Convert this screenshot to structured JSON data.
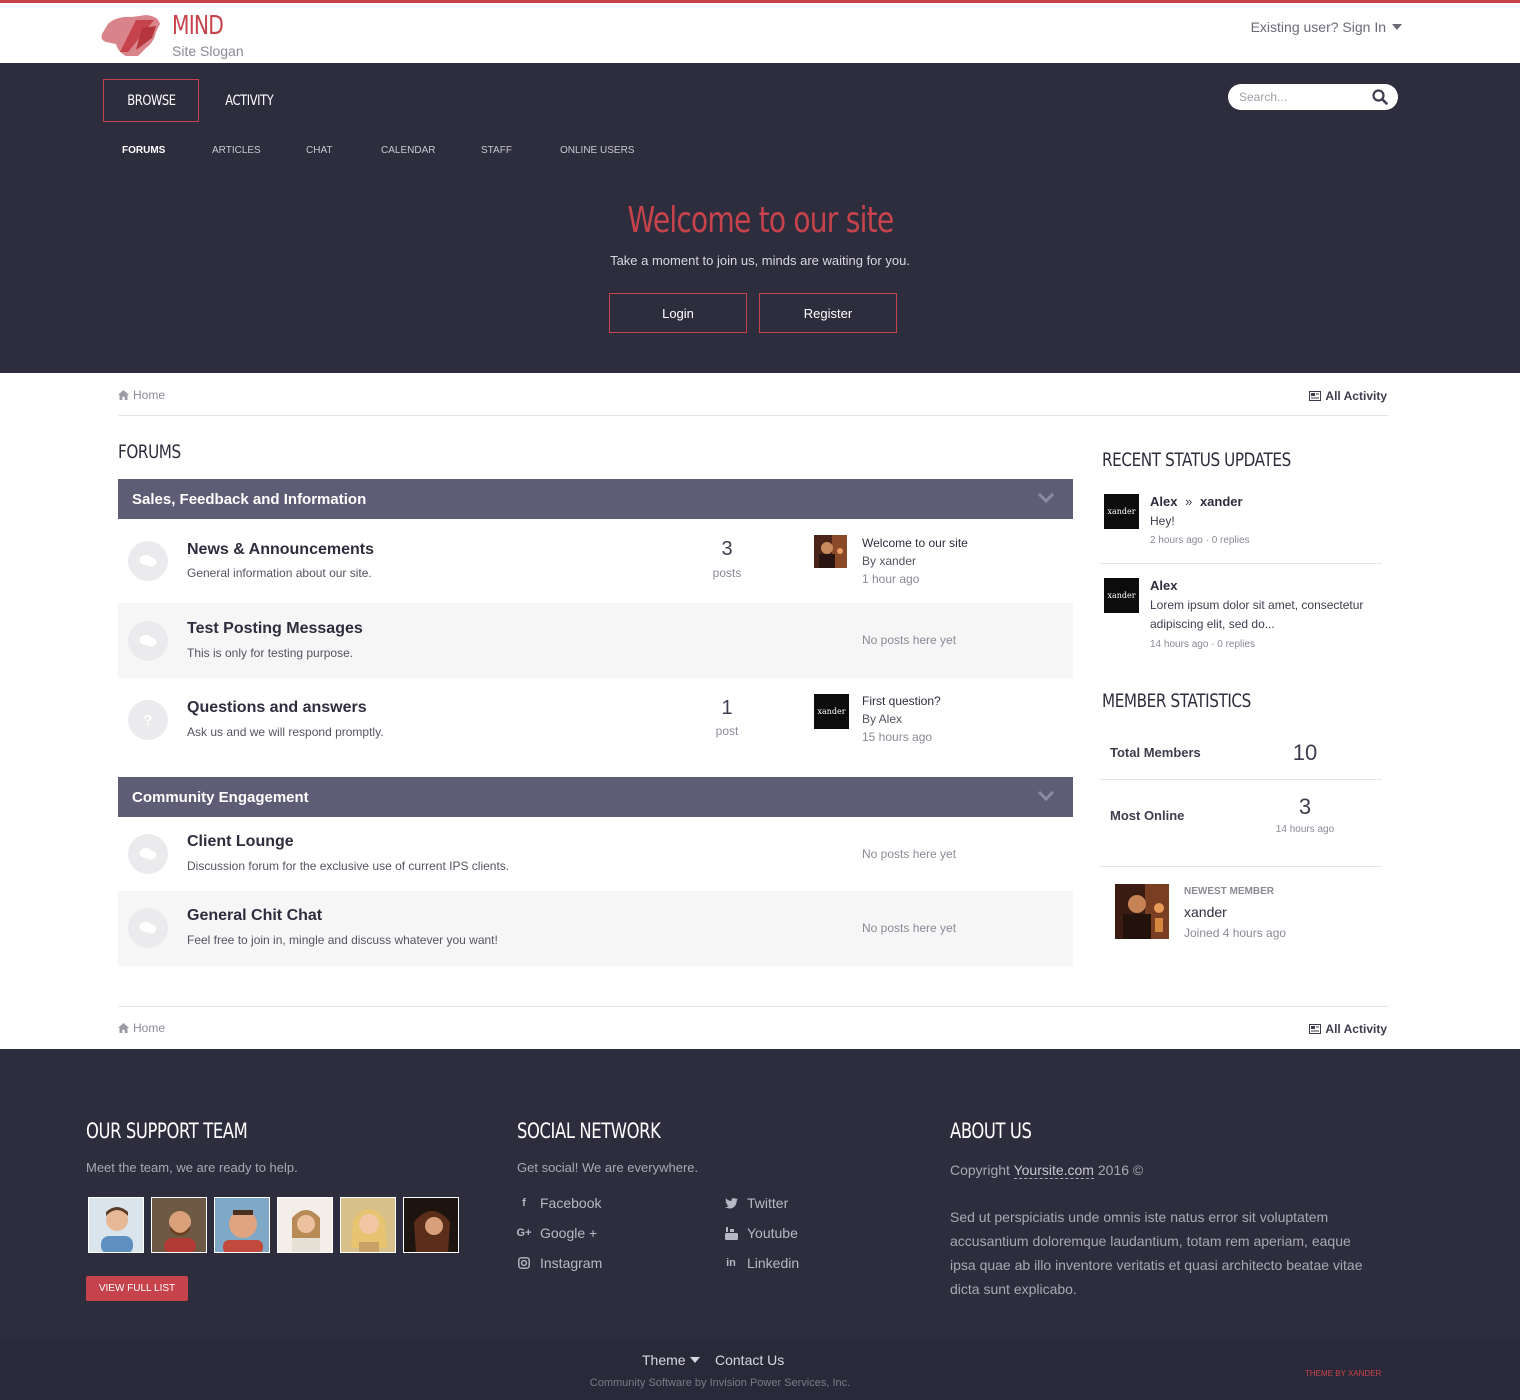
{
  "header": {
    "logo_title": "MIND",
    "logo_slogan": "Site Slogan",
    "signin_label": "Existing user? Sign In"
  },
  "nav": {
    "primary": [
      {
        "label": "BROWSE",
        "active": true
      },
      {
        "label": "ACTIVITY",
        "active": false
      }
    ],
    "secondary": [
      {
        "label": "FORUMS",
        "active": true
      },
      {
        "label": "ARTICLES"
      },
      {
        "label": "CHAT"
      },
      {
        "label": "CALENDAR"
      },
      {
        "label": "STAFF"
      },
      {
        "label": "ONLINE USERS"
      }
    ],
    "search_placeholder": "Search..."
  },
  "hero": {
    "title": "Welcome to our site",
    "subtitle": "Take a moment to join us, minds are waiting for you.",
    "login_label": "Login",
    "register_label": "Register"
  },
  "breadcrumb": {
    "home": "Home",
    "all_activity": "All Activity"
  },
  "forums": {
    "title": "FORUMS",
    "categories": [
      {
        "name": "Sales, Feedback and Information",
        "forums": [
          {
            "name": "News & Announcements",
            "desc": "General information about our site.",
            "count": "3",
            "count_label": "posts",
            "last_title": "Welcome to our site",
            "last_by": "By xander",
            "last_time": "1 hour ago"
          },
          {
            "name": "Test Posting Messages",
            "desc": "This is only for testing purpose.",
            "no_posts": "No posts here yet"
          },
          {
            "name": "Questions and answers",
            "desc": "Ask us and we will respond promptly.",
            "count": "1",
            "count_label": "post",
            "last_title": "First question?",
            "last_by": "By Alex",
            "last_time": "15 hours ago"
          }
        ]
      },
      {
        "name": "Community Engagement",
        "forums": [
          {
            "name": "Client Lounge",
            "desc": "Discussion forum for the exclusive use of current IPS clients.",
            "no_posts": "No posts here yet"
          },
          {
            "name": "General Chit Chat",
            "desc": "Feel free to join in, mingle and discuss whatever you want!",
            "no_posts": "No posts here yet"
          }
        ]
      }
    ]
  },
  "sidebar": {
    "status_title": "RECENT STATUS UPDATES",
    "statuses": [
      {
        "author": "Alex",
        "target": "xander",
        "text": "Hey!",
        "meta": "2 hours ago · 0 replies"
      },
      {
        "author": "Alex",
        "text": "Lorem ipsum dolor sit amet, consectetur adipiscing elit, sed do...",
        "meta": "14 hours ago · 0 replies"
      }
    ],
    "avatar_text": "xander",
    "stats_title": "MEMBER STATISTICS",
    "total_members_label": "Total Members",
    "total_members_value": "10",
    "most_online_label": "Most Online",
    "most_online_value": "3",
    "most_online_time": "14 hours ago",
    "newest_label": "NEWEST MEMBER",
    "newest_name": "xander",
    "newest_joined": "Joined 4 hours ago"
  },
  "footer": {
    "support_title": "OUR SUPPORT TEAM",
    "support_text": "Meet the team, we are ready to help.",
    "view_full_list": "VIEW FULL LIST",
    "social_title": "SOCIAL NETWORK",
    "social_text": "Get social! We are everywhere.",
    "social": [
      {
        "label": "Facebook",
        "icon": "facebook-icon"
      },
      {
        "label": "Twitter",
        "icon": "twitter-icon"
      },
      {
        "label": "Google +",
        "icon": "google-plus-icon"
      },
      {
        "label": "Youtube",
        "icon": "youtube-icon"
      },
      {
        "label": "Instagram",
        "icon": "instagram-icon"
      },
      {
        "label": "Linkedin",
        "icon": "linkedin-icon"
      }
    ],
    "about_title": "ABOUT US",
    "copyright_prefix": "Copyright",
    "copyright_site": "Yoursite.com",
    "copyright_suffix": "2016 ©",
    "about_text": "Sed ut perspiciatis unde omnis iste natus error sit voluptatem accusantium doloremque laudantium, totam rem aperiam, eaque ipsa quae ab illo inventore veritatis et quasi architecto beatae vitae dicta sunt explicabo.",
    "theme_label": "Theme",
    "contact_label": "Contact Us",
    "powered_by": "Community Software by Invision Power Services, Inc.",
    "theme_by": "THEME BY XANDER"
  },
  "colors": {
    "accent": "#c7434b",
    "dark_bg": "#2e2d3e",
    "category_bar": "#5e5d75"
  }
}
